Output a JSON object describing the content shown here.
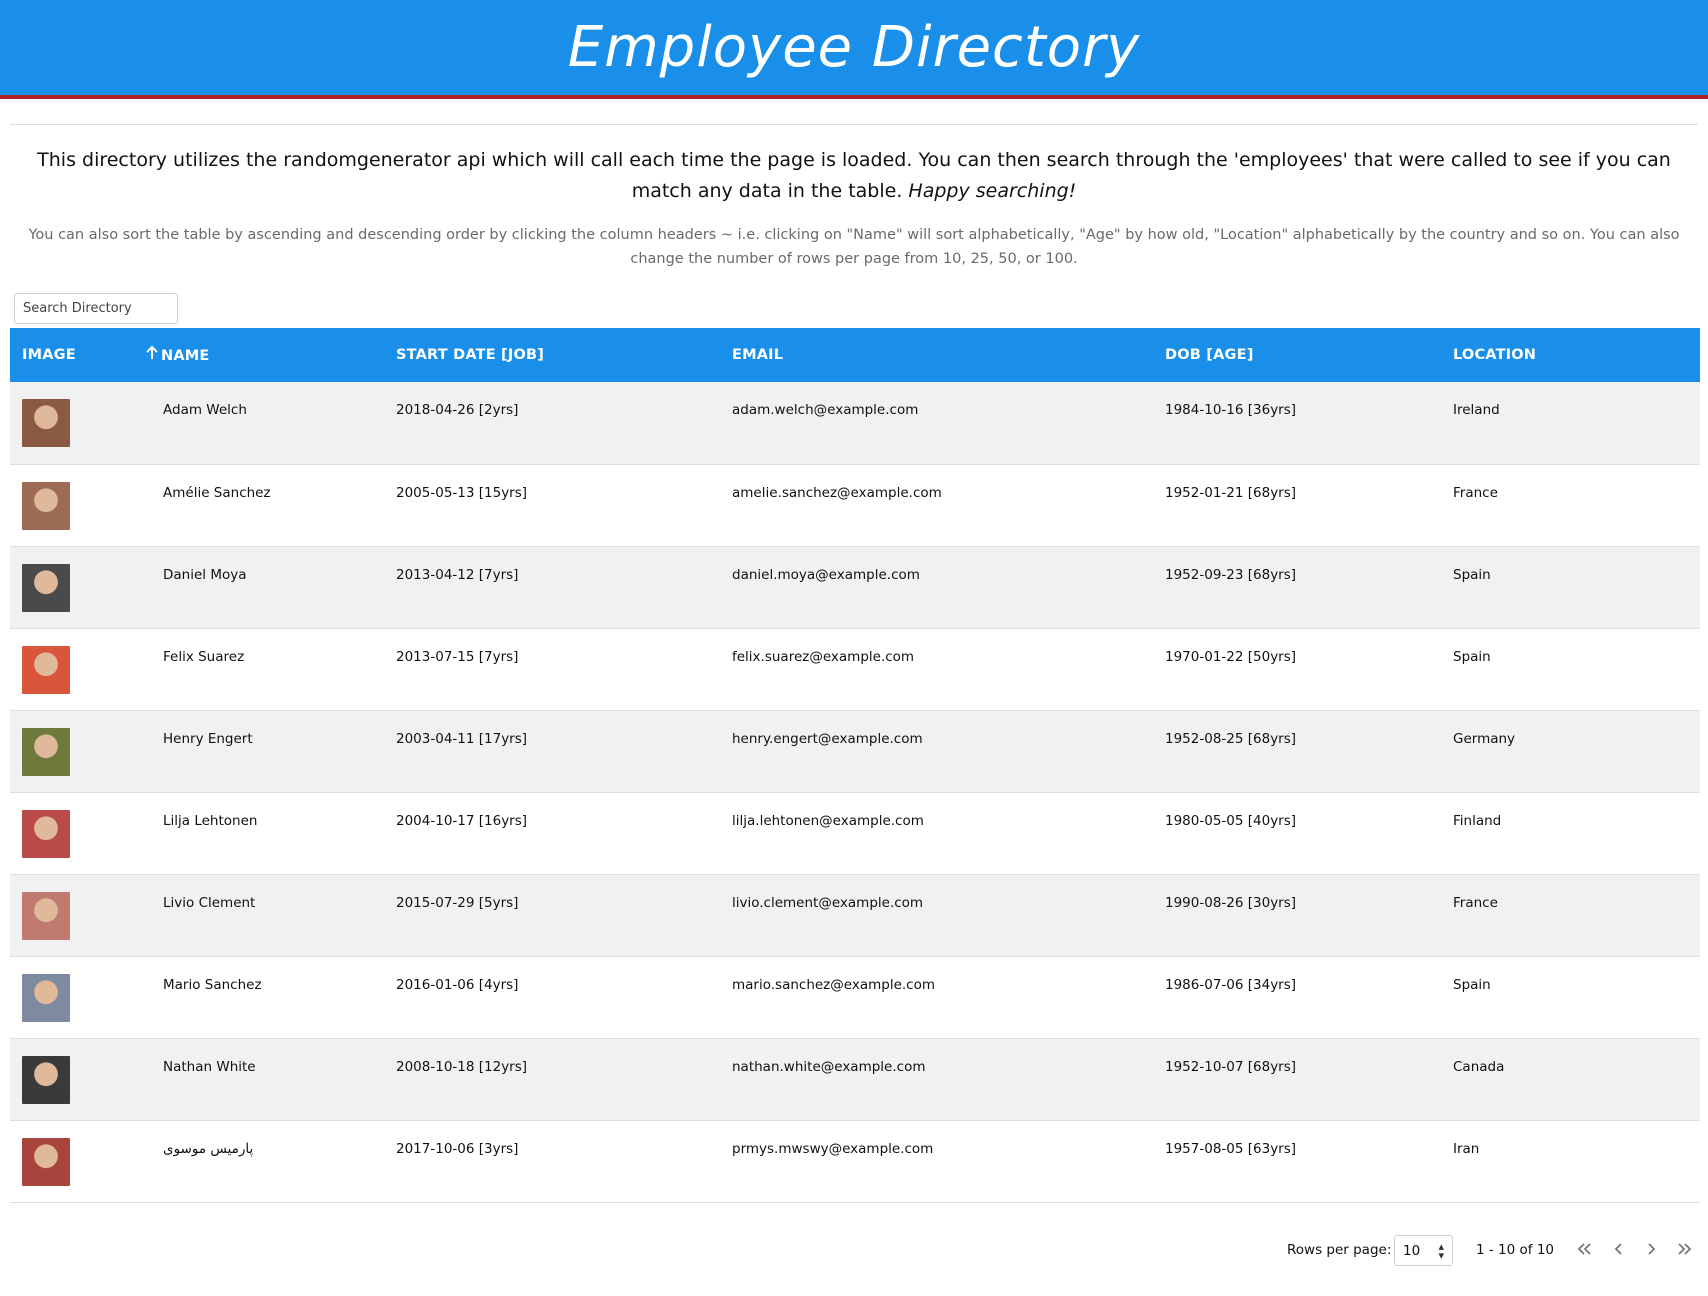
{
  "header": {
    "title": "Employee Directory"
  },
  "intro": {
    "text": "This directory utilizes the randomgenerator api which will call each time the page is loaded. You can then search through the 'employees' that were called to see if you can match any data in the table.",
    "emphasis": "Happy searching!"
  },
  "note": "You can also sort the table by ascending and descending order by clicking the column headers ~ i.e. clicking on \"Name\" will sort alphabetically, \"Age\" by how old, \"Location\" alphabetically by the country and so on. You can also change the number of rows per page from 10, 25, 50, or 100.",
  "search": {
    "placeholder": "Search Directory",
    "value": ""
  },
  "table": {
    "columns": [
      "IMAGE",
      "NAME",
      "START DATE [JOB]",
      "EMAIL",
      "DOB [AGE]",
      "LOCATION"
    ],
    "sort": {
      "column": "NAME",
      "direction": "ascending",
      "icon": "arrow-up-icon"
    },
    "rows": [
      {
        "name": "Adam Welch",
        "start": "2018-04-26 [2yrs]",
        "email": "adam.welch@example.com",
        "dob": "1984-10-16 [36yrs]",
        "location": "Ireland",
        "avatar_color": "#8a5a44"
      },
      {
        "name": "Amélie Sanchez",
        "start": "2005-05-13 [15yrs]",
        "email": "amelie.sanchez@example.com",
        "dob": "1952-01-21 [68yrs]",
        "location": "France",
        "avatar_color": "#9c6b55"
      },
      {
        "name": "Daniel Moya",
        "start": "2013-04-12 [7yrs]",
        "email": "daniel.moya@example.com",
        "dob": "1952-09-23 [68yrs]",
        "location": "Spain",
        "avatar_color": "#4a4a4a"
      },
      {
        "name": "Felix Suarez",
        "start": "2013-07-15 [7yrs]",
        "email": "felix.suarez@example.com",
        "dob": "1970-01-22 [50yrs]",
        "location": "Spain",
        "avatar_color": "#d9553c"
      },
      {
        "name": "Henry Engert",
        "start": "2003-04-11 [17yrs]",
        "email": "henry.engert@example.com",
        "dob": "1952-08-25 [68yrs]",
        "location": "Germany",
        "avatar_color": "#6e7a3c"
      },
      {
        "name": "Lilja Lehtonen",
        "start": "2004-10-17 [16yrs]",
        "email": "lilja.lehtonen@example.com",
        "dob": "1980-05-05 [40yrs]",
        "location": "Finland",
        "avatar_color": "#b84a4a"
      },
      {
        "name": "Livio Clement",
        "start": "2015-07-29 [5yrs]",
        "email": "livio.clement@example.com",
        "dob": "1990-08-26 [30yrs]",
        "location": "France",
        "avatar_color": "#c07a70"
      },
      {
        "name": "Mario Sanchez",
        "start": "2016-01-06 [4yrs]",
        "email": "mario.sanchez@example.com",
        "dob": "1986-07-06 [34yrs]",
        "location": "Spain",
        "avatar_color": "#7d8aa0"
      },
      {
        "name": "Nathan White",
        "start": "2008-10-18 [12yrs]",
        "email": "nathan.white@example.com",
        "dob": "1952-10-07 [68yrs]",
        "location": "Canada",
        "avatar_color": "#3a3a3a"
      },
      {
        "name": "پارمیس موسوی",
        "start": "2017-10-06 [3yrs]",
        "email": "prmys.mwswy@example.com",
        "dob": "1957-08-05 [63yrs]",
        "location": "Iran",
        "avatar_color": "#a8443c"
      }
    ]
  },
  "pagination": {
    "rows_label": "Rows per page:",
    "rows_value": "10",
    "range": "1 - 10 of 10",
    "icons": [
      "first-page-icon",
      "previous-page-icon",
      "next-page-icon",
      "last-page-icon"
    ]
  }
}
